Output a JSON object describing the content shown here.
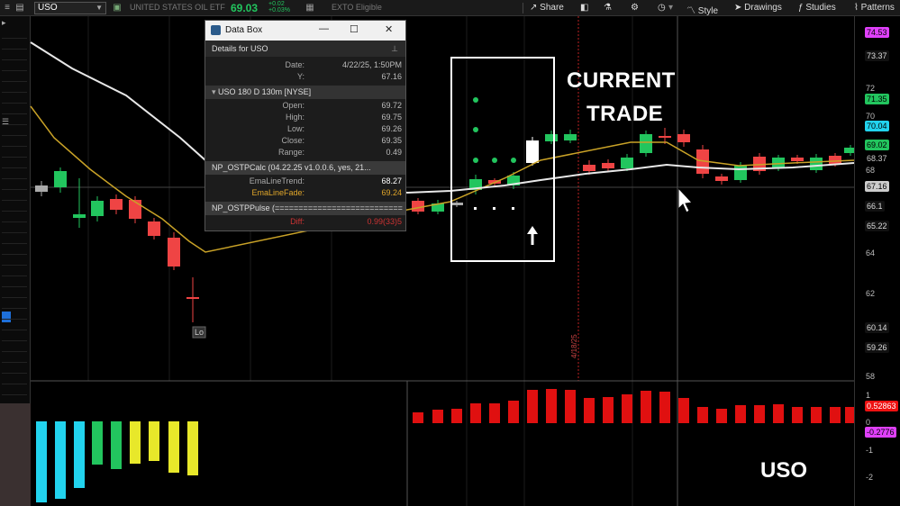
{
  "toolbar": {
    "symbol": "USO",
    "company": "UNITED STATES OIL ETF",
    "last_price": "69.03",
    "change_top": "+0.02",
    "change_bottom": "+0.03%",
    "etb": "EXTO Eligible",
    "share": "Share",
    "style": "Style",
    "drawings": "Drawings",
    "studies": "Studies",
    "patterns": "Patterns"
  },
  "databox": {
    "title": "Data Box",
    "details": "Details for USO",
    "rows_top": [
      {
        "k": "Date:",
        "v": "4/22/25, 1:50PM"
      },
      {
        "k": "Y:",
        "v": "67.16"
      }
    ],
    "series_header": "USO 180 D 130m [NYSE]",
    "rows_ohlc": [
      {
        "k": "Open:",
        "v": "69.72"
      },
      {
        "k": "High:",
        "v": "69.75"
      },
      {
        "k": "Low:",
        "v": "69.26"
      },
      {
        "k": "Close:",
        "v": "69.35"
      },
      {
        "k": "Range:",
        "v": "0.49"
      }
    ],
    "study1_header": "NP_OSTPCalc (04.22.25 v1.0.0.6, yes, 21...",
    "rows_study1": [
      {
        "k": "EmaLineTrend:",
        "v": "68.27"
      },
      {
        "k": "EmaLineFade:",
        "v": "69.24"
      }
    ],
    "study2_header": "NP_OSTPPulse (===========================",
    "rows_study2": [
      {
        "k": "Diff:",
        "v": "0.99(33)5"
      }
    ]
  },
  "annotation": {
    "line1": "CURRENT",
    "line2": "TRADE",
    "symbol_label": "USO"
  },
  "chart_labels": {
    "lo_tag": "Lo",
    "date_marker": "4/18/25"
  },
  "yaxis_price": {
    "ticks": [
      "72",
      "70",
      "68",
      "66",
      "64",
      "62",
      "58"
    ],
    "badges": [
      {
        "text": "74.53",
        "bg": "#e040fb",
        "fg": "#000"
      },
      {
        "text": "73.37",
        "bg": "#111",
        "fg": "#ddd"
      },
      {
        "text": "71.35",
        "bg": "#22c55e",
        "fg": "#000"
      },
      {
        "text": "70.04",
        "bg": "#22d3ee",
        "fg": "#000"
      },
      {
        "text": "69.02",
        "bg": "#22c55e",
        "fg": "#000"
      },
      {
        "text": "68.37",
        "bg": "#000",
        "fg": "#ccc"
      },
      {
        "text": "67.16",
        "bg": "#ccc",
        "fg": "#000"
      },
      {
        "text": "66.1",
        "bg": "#111",
        "fg": "#ddd"
      },
      {
        "text": "65.22",
        "bg": "#111",
        "fg": "#ddd"
      },
      {
        "text": "60.14",
        "bg": "#111",
        "fg": "#ddd"
      },
      {
        "text": "59.26",
        "bg": "#111",
        "fg": "#ddd"
      }
    ]
  },
  "yaxis_lower": {
    "ticks": [
      "1",
      "0",
      "-1",
      "-2"
    ],
    "badges": [
      {
        "text": "0.52863",
        "bg": "#e11",
        "fg": "#fff"
      },
      {
        "text": "-0.2776",
        "bg": "#e040fb",
        "fg": "#000"
      }
    ]
  },
  "colors": {
    "up": "#22c55e",
    "down": "#ef4444",
    "ema_trend": "#e8e8e8",
    "ema_fade": "#c9a227",
    "bg": "#000000"
  }
}
